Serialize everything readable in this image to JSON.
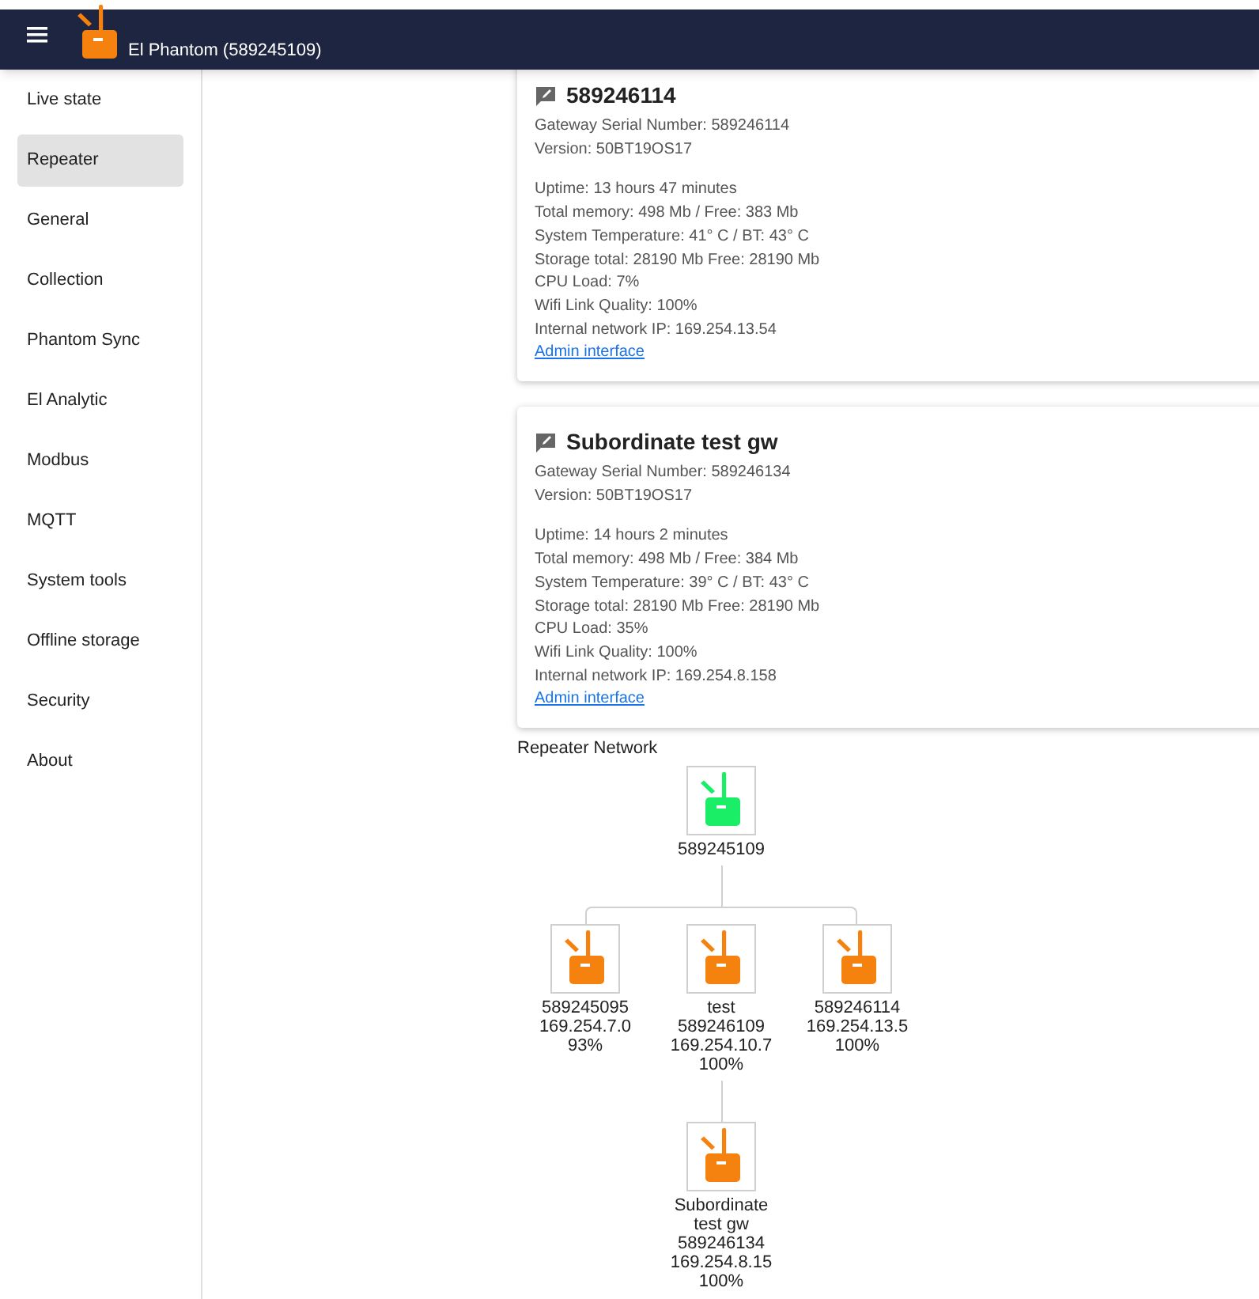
{
  "header": {
    "title": "El Phantom (589245109)"
  },
  "sidebar": {
    "items": [
      {
        "label": "Live state",
        "selected": false
      },
      {
        "label": "Repeater",
        "selected": true
      },
      {
        "label": "General",
        "selected": false
      },
      {
        "label": "Collection",
        "selected": false
      },
      {
        "label": "Phantom Sync",
        "selected": false
      },
      {
        "label": "El Analytic",
        "selected": false
      },
      {
        "label": "Modbus",
        "selected": false
      },
      {
        "label": "MQTT",
        "selected": false
      },
      {
        "label": "System tools",
        "selected": false
      },
      {
        "label": "Offline storage",
        "selected": false
      },
      {
        "label": "Security",
        "selected": false
      },
      {
        "label": "About",
        "selected": false
      }
    ]
  },
  "cards": [
    {
      "title": "589246114",
      "identity": [
        "Gateway Serial Number: 589246114",
        "Version: 50BT19OS17"
      ],
      "stats": [
        "Uptime: 13 hours 47 minutes",
        "Total memory: 498 Mb / Free: 383 Mb",
        "System Temperature: 41° C / BT: 43° C",
        "Storage total: 28190 Mb Free: 28190 Mb",
        "CPU Load: 7%",
        "Wifi Link Quality: 100%",
        "Internal network IP: 169.254.13.54"
      ],
      "link": "Admin interface"
    },
    {
      "title": "Subordinate test gw",
      "identity": [
        "Gateway Serial Number: 589246134",
        "Version: 50BT19OS17"
      ],
      "stats": [
        "Uptime: 14 hours 2 minutes",
        "Total memory: 498 Mb / Free: 384 Mb",
        "System Temperature: 39° C / BT: 43° C",
        "Storage total: 28190 Mb Free: 28190 Mb",
        "CPU Load: 35%",
        "Wifi Link Quality: 100%",
        "Internal network IP: 169.254.8.158"
      ],
      "link": "Admin interface"
    }
  ],
  "network": {
    "title": "Repeater Network",
    "root": {
      "color": "#19ee66",
      "lines": [
        "589245109"
      ],
      "children": [
        {
          "color": "#f5820f",
          "lines": [
            "589245095",
            "169.254.7.0",
            "93%"
          ]
        },
        {
          "color": "#f5820f",
          "lines": [
            "test",
            "589246109",
            "169.254.10.7",
            "100%"
          ],
          "children": [
            {
              "color": "#f5820f",
              "lines": [
                "Subordinate test gw",
                "589246134",
                "169.254.8.15",
                "100%"
              ]
            }
          ]
        },
        {
          "color": "#f5820f",
          "lines": [
            "589246114",
            "169.254.13.5",
            "100%"
          ]
        }
      ]
    }
  }
}
